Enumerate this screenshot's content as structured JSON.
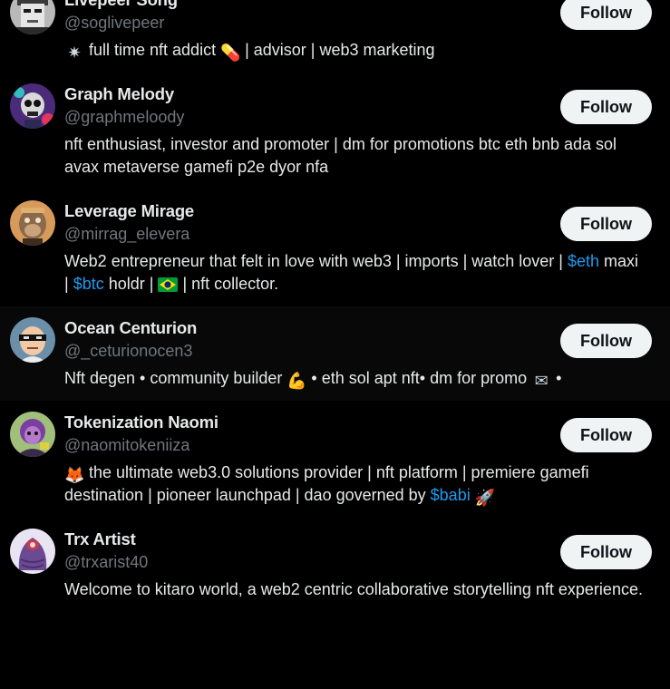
{
  "users": [
    {
      "name": "Livepeer Song",
      "handle": "@soglivepeer",
      "bio": [
        {
          "t": "emoji",
          "icon": "sparkle-emoji",
          "glyph": "✷",
          "color": "#cfd9de"
        },
        {
          "t": "text",
          "v": " full time nft addict "
        },
        {
          "t": "emoji",
          "icon": "pill-emoji",
          "glyph": "💊",
          "color": "#f4900c"
        },
        {
          "t": "text",
          "v": " | advisor | web3 marketing"
        }
      ],
      "follow_label": "Follow",
      "avatar": "pixel-punk-avatar"
    },
    {
      "name": "Graph Melody",
      "handle": "@graphmeloody",
      "bio": [
        {
          "t": "text",
          "v": "nft enthusiast, investor and promoter | dm for promotions btc eth bnb ada sol avax metaverse gamefi p2e dyor nfa"
        }
      ],
      "follow_label": "Follow",
      "avatar": "skull-avatar"
    },
    {
      "name": "Leverage Mirage",
      "handle": "@mirrag_elevera",
      "bio": [
        {
          "t": "text",
          "v": "Web2 entrepreneur that felt in love with web3 | imports | watch lover | "
        },
        {
          "t": "cashtag",
          "v": "$eth"
        },
        {
          "t": "text",
          "v": " maxi | "
        },
        {
          "t": "cashtag",
          "v": "$btc"
        },
        {
          "t": "text",
          "v": " holdr | "
        },
        {
          "t": "emoji",
          "icon": "brazil-flag-emoji",
          "glyph": "",
          "color": "#009c3b"
        },
        {
          "t": "text",
          "v": " | nft collector."
        }
      ],
      "follow_label": "Follow",
      "avatar": "ape-avatar"
    },
    {
      "name": "Ocean Centurion",
      "handle": "@_ceturionocen3",
      "bio": [
        {
          "t": "text",
          "v": "Nft degen • community builder "
        },
        {
          "t": "emoji",
          "icon": "flexed-biceps-emoji",
          "glyph": "💪",
          "color": "#ffdbc9"
        },
        {
          "t": "text",
          "v": " • eth sol apt nft• dm for promo "
        },
        {
          "t": "emoji",
          "icon": "envelope-emoji",
          "glyph": "✉",
          "color": "#c8d2dc"
        },
        {
          "t": "text",
          "v": " •"
        }
      ],
      "follow_label": "Follow",
      "avatar": "masked-character-avatar",
      "hovered": true
    },
    {
      "name": "Tokenization Naomi",
      "handle": "@naomitokeniiza",
      "bio": [
        {
          "t": "emoji",
          "icon": "fox-emoji",
          "glyph": "🦊",
          "color": "#f4900c"
        },
        {
          "t": "text",
          "v": " the ultimate web3.0 solutions provider | nft platform | premiere gamefi destination | pioneer launchpad | dao governed by "
        },
        {
          "t": "cashtag",
          "v": "$babi"
        },
        {
          "t": "text",
          "v": " "
        },
        {
          "t": "emoji",
          "icon": "rocket-emoji",
          "glyph": "🚀",
          "color": "#8899a6"
        }
      ],
      "follow_label": "Follow",
      "avatar": "purple-character-avatar"
    },
    {
      "name": "Trx Artist",
      "handle": "@trxarist40",
      "bio": [
        {
          "t": "text",
          "v": "Welcome to kitaro world, a web2 centric collaborative storytelling nft experience."
        }
      ],
      "follow_label": "Follow",
      "avatar": "purple-blob-avatar"
    }
  ],
  "colors": {
    "background": "#000000",
    "hover_row": "#080808",
    "text_primary": "#e7e9ea",
    "text_secondary": "#71767b",
    "accent": "#1d9bf0",
    "button_bg": "#eff3f4",
    "button_text": "#0f1419"
  }
}
